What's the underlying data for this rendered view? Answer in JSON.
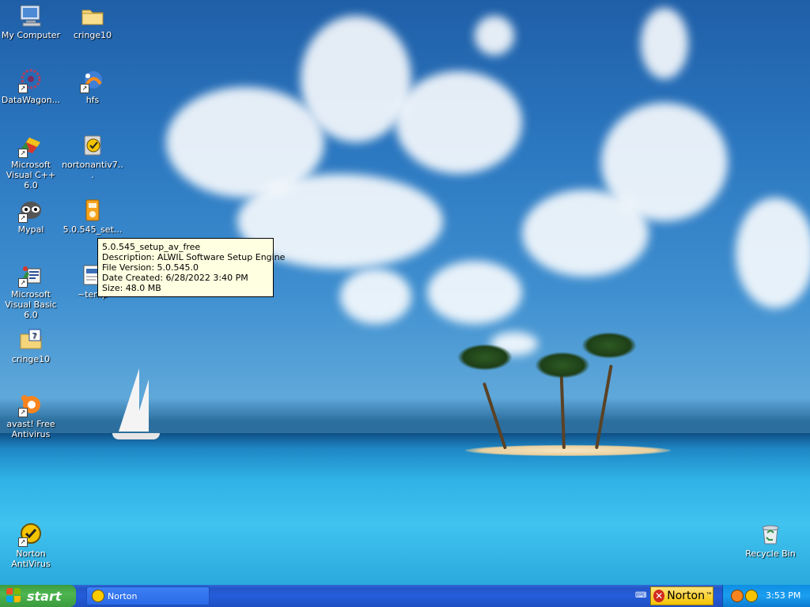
{
  "desktop_icons": [
    {
      "label": "My Computer",
      "icon": "computer-icon"
    },
    {
      "label": "cringe10",
      "icon": "folder-icon"
    },
    {
      "label": "DataWagon...",
      "icon": "datawagon-icon"
    },
    {
      "label": "hfs",
      "icon": "hfs-icon"
    },
    {
      "label": "Microsoft Visual C++ 6.0",
      "icon": "visual-cpp-icon"
    },
    {
      "label": "nortonantiv7...",
      "icon": "norton-installer-icon"
    },
    {
      "label": "Mypal",
      "icon": "mypal-icon"
    },
    {
      "label": "5.0.545_set...",
      "icon": "setup-file-icon"
    },
    {
      "label": "Microsoft Visual Basic 6.0",
      "icon": "visual-basic-icon"
    },
    {
      "label": "~temp",
      "icon": "temp-file-icon"
    },
    {
      "label": "cringe10",
      "icon": "zip-folder-icon"
    },
    {
      "label": "avast! Free Antivirus",
      "icon": "avast-icon"
    },
    {
      "label": "Norton AntiVirus",
      "icon": "norton-antivirus-icon"
    },
    {
      "label": "Recycle Bin",
      "icon": "recycle-bin-icon"
    }
  ],
  "tooltip": {
    "lines": [
      "5.0.545_setup_av_free",
      "Description: ALWIL Software Setup Engine",
      "File Version: 5.0.545.0",
      "Date Created: 6/28/2022 3:40 PM",
      "Size: 48.0 MB"
    ]
  },
  "taskbar": {
    "start_label": "start",
    "tasks": [
      {
        "label": "Norton"
      }
    ],
    "norton_button_label": "Norton",
    "clock": "3:53 PM"
  },
  "colors": {
    "taskbar_blue": "#245dda",
    "start_green": "#3b9b3f",
    "tooltip_bg": "#ffffe1",
    "tray_blue": "#0f8ee3"
  }
}
